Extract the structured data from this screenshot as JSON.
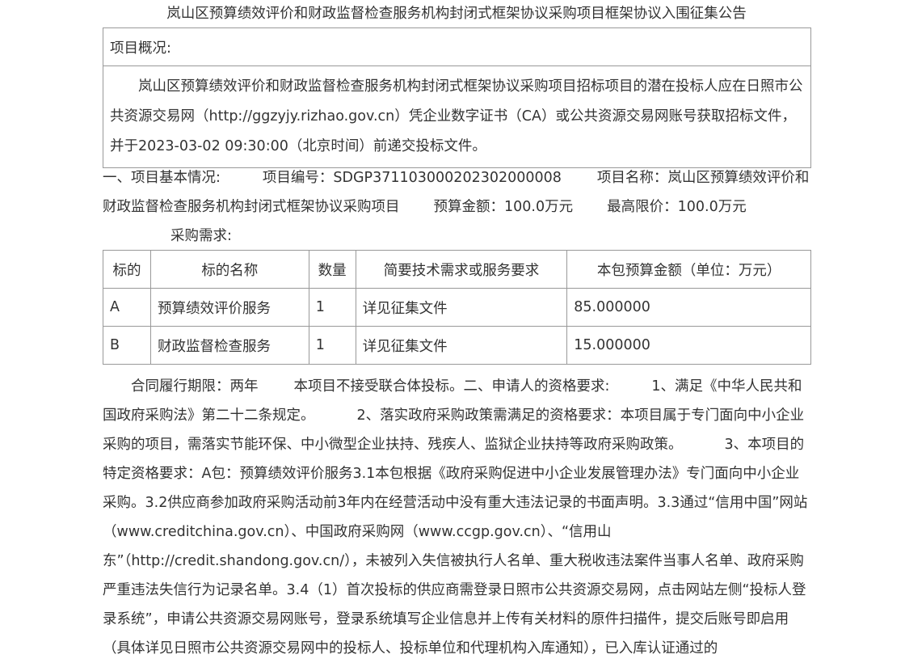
{
  "title": "岚山区预算绩效评价和财政监督检查服务机构封闭式框架协议采购项目框架协议入围征集公告",
  "overview": {
    "label": "项目概况:",
    "text": "岚山区预算绩效评价和财政监督检查服务机构封闭式框架协议采购项目招标项目的潜在投标人应在日照市公共资源交易网（http://ggzyjy.rizhao.gov.cn）凭企业数字证书（CA）或公共资源交易网账号获取招标文件，并于2023-03-02 09:30:00（北京时间）前递交投标文件。"
  },
  "basic": {
    "heading": "一、项目基本情况:",
    "project_no": "项目编号：SDGP371103000202302000008",
    "project_name": "项目名称：岚山区预算绩效评价和财政监督检查服务机构封闭式框架协议采购项目",
    "budget": "预算金额：100.0万元",
    "max_price": "最高限价：100.0万元",
    "requirement_label": "采购需求:"
  },
  "table": {
    "headers": [
      "标的",
      "标的名称",
      "数量",
      "简要技术需求或服务要求",
      "本包预算金额（单位：万元）"
    ],
    "rows": [
      [
        "A",
        "预算绩效评价服务",
        "1",
        "详见征集文件",
        "85.000000"
      ],
      [
        "B",
        "财政监督检查服务",
        "1",
        "详见征集文件",
        "15.000000"
      ]
    ]
  },
  "body_text": {
    "contract_period": "合同履行期限：两年",
    "no_consortium": "本项目不接受联合体投标。二、申请人的资格要求:",
    "req1": "1、满足《中华人民共和国政府采购法》第二十二条规定。",
    "req2": "2、落实政府采购政策需满足的资格要求：本项目属于专门面向中小企业采购的项目，需落实节能环保、中小微型企业扶持、残疾人、监狱企业扶持等政府采购政策。",
    "req3": "3、本项目的特定资格要求：A包：预算绩效评价服务3.1本包根据《政府采购促进中小企业发展管理办法》专门面向中小企业采购。3.2供应商参加政府采购活动前3年内在经营活动中没有重大违法记录的书面声明。3.3通过“信用中国”网站（www.creditchina.gov.cn）、中国政府采购网（www.ccgp.gov.cn）、“信用山东”（http://credit.shandong.gov.cn/），未被列入失信被执行人名单、重大税收违法案件当事人名单、政府采购严重违法失信行为记录名单。3.4（1）首次投标的供应商需登录日照市公共资源交易网，点击网站左侧“投标人登录系统”，申请公共资源交易网账号，登录系统填写企业信息并上传有关材料的原件扫描件，提交后账号即启用（具体详见日照市公共资源交易网中的投标人、投标单位和代理机构入库通知），已入库认证通过的"
  }
}
